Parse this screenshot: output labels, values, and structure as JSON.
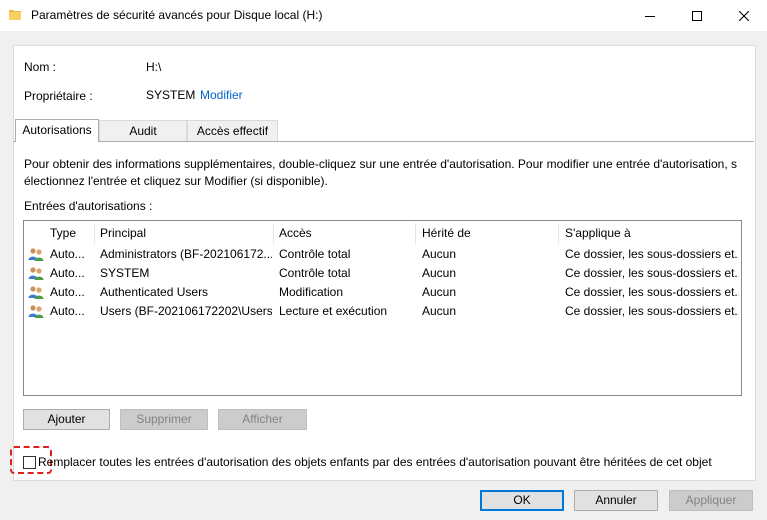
{
  "window": {
    "title": "Paramètres de sécurité avancés pour Disque local (H:)",
    "icon": "folder-icon",
    "controls": [
      "minimize-icon",
      "maximize-icon",
      "close-icon"
    ]
  },
  "info": {
    "name_label": "Nom :",
    "name_value": "H:\\",
    "owner_label": "Propriétaire :",
    "owner_value": "SYSTEM",
    "owner_link": "Modifier"
  },
  "tabs": [
    {
      "label": "Autorisations",
      "active": true
    },
    {
      "label": "Audit",
      "active": false
    },
    {
      "label": "Accès effectif",
      "active": false
    }
  ],
  "description_line1": "Pour obtenir des informations supplémentaires, double-cliquez sur une entrée d'autorisation. Pour modifier une entrée d'autorisation, s",
  "description_line2": "électionnez l'entrée et cliquez sur Modifier (si disponible).",
  "entries_label": "Entrées d'autorisations :",
  "table": {
    "columns": [
      "Type",
      "Principal",
      "Accès",
      "Hérité de",
      "S'applique à"
    ],
    "rows": [
      {
        "type": "Auto...",
        "principal": "Administrators (BF-202106172...",
        "access": "Contrôle total",
        "inherited": "Aucun",
        "applies": "Ce dossier, les sous-dossiers et..."
      },
      {
        "type": "Auto...",
        "principal": "SYSTEM",
        "access": "Contrôle total",
        "inherited": "Aucun",
        "applies": "Ce dossier, les sous-dossiers et..."
      },
      {
        "type": "Auto...",
        "principal": "Authenticated Users",
        "access": "Modification",
        "inherited": "Aucun",
        "applies": "Ce dossier, les sous-dossiers et..."
      },
      {
        "type": "Auto...",
        "principal": "Users (BF-202106172202\\Users)",
        "access": "Lecture et exécution",
        "inherited": "Aucun",
        "applies": "Ce dossier, les sous-dossiers et..."
      }
    ]
  },
  "buttons": {
    "add": "Ajouter",
    "remove": "Supprimer",
    "view": "Afficher",
    "ok": "OK",
    "cancel": "Annuler",
    "apply": "Appliquer"
  },
  "replace_checkbox": {
    "label": "Remplacer toutes les entrées d'autorisation des objets enfants par des entrées d'autorisation pouvant être héritées de cet objet",
    "checked": false
  },
  "colors": {
    "link": "#0066cc",
    "highlight": "#e02020",
    "primary_border": "#0078d7"
  }
}
